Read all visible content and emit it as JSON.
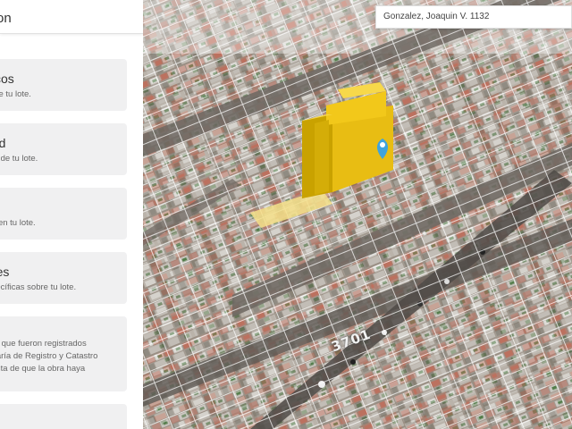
{
  "panel": {
    "title": "on",
    "cards": [
      {
        "title": "ísicos",
        "desc": [
          "sobre tu lote."
        ]
      },
      {
        "title": "idad",
        "desc": [
          "idad de tu lote."
        ]
      },
      {
        "title": "",
        "desc": [
          "dos en tu lote."
        ]
      },
      {
        "title": "ones",
        "desc": [
          "específicas sobre tu lote."
        ]
      },
      {
        "title": "",
        "desc": [
          "obra que fueron registrados",
          "cretaría de Registro y Catastro",
          "cuenta de que la obra haya"
        ]
      },
      {
        "title": "",
        "desc": []
      }
    ]
  },
  "map": {
    "search_value": "Gonzalez, Joaquin V. 1132",
    "street_number": "3701",
    "marker_icon": "location-pin-icon",
    "colors": {
      "building": "#f2c81a",
      "building_side": "#c9a200",
      "lot": "#f6e08a",
      "marker": "#3fa3dd",
      "lot_lines": "#ffffff"
    }
  }
}
